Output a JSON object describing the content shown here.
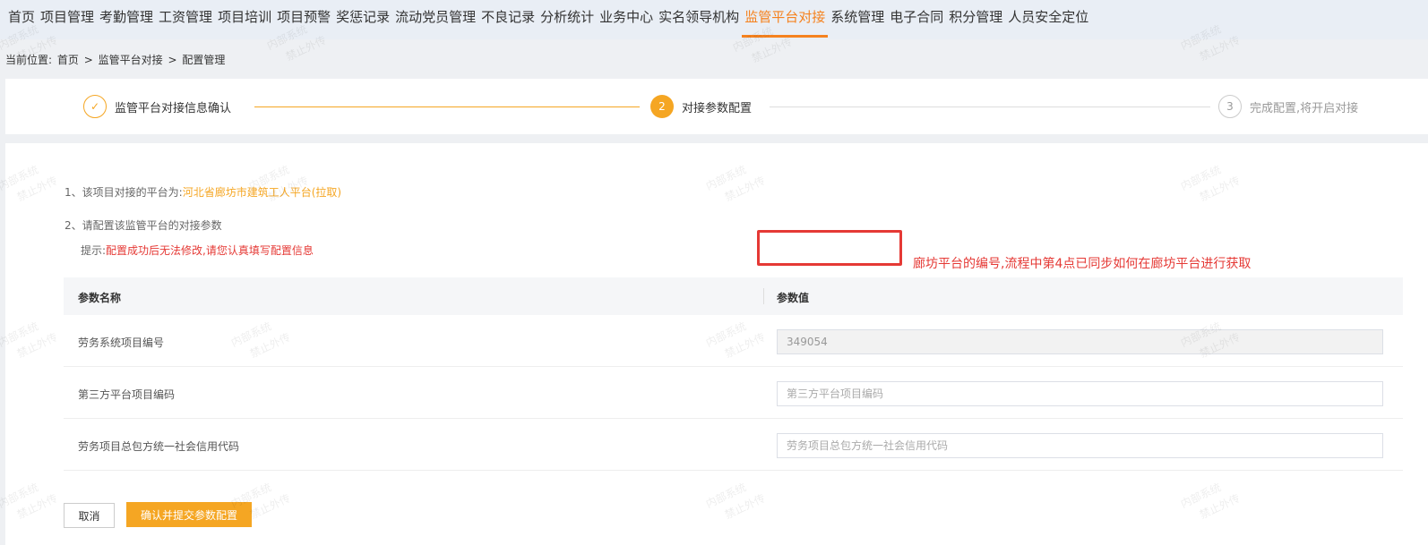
{
  "nav": {
    "items": [
      "首页",
      "项目管理",
      "考勤管理",
      "工资管理",
      "项目培训",
      "项目预警",
      "奖惩记录",
      "流动党员管理",
      "不良记录",
      "分析统计",
      "业务中心",
      "实名领导机构",
      "监管平台对接",
      "系统管理",
      "电子合同",
      "积分管理",
      "人员安全定位"
    ],
    "active": "监管平台对接"
  },
  "breadcrumb": {
    "prefix": "当前位置:",
    "path": [
      "首页",
      ">",
      "监管平台对接",
      ">",
      "配置管理"
    ]
  },
  "steps": [
    {
      "index": "✓",
      "label": "监管平台对接信息确认",
      "state": "done"
    },
    {
      "index": "2",
      "label": "对接参数配置",
      "state": "current"
    },
    {
      "index": "3",
      "label": "完成配置,将开启对接",
      "state": "pending"
    }
  ],
  "info": {
    "line1_prefix": "1、该项目对接的平台为:",
    "line1_platform": "河北省廊坊市建筑工人平台(拉取)",
    "line2": "2、请配置该监管平台的对接参数",
    "hint_prefix": "提示:",
    "hint_text": "配置成功后无法修改,请您认真填写配置信息"
  },
  "table": {
    "col_name": "参数名称",
    "col_value": "参数值",
    "rows": [
      {
        "name": "劳务系统项目编号",
        "value": "349054",
        "placeholder": "",
        "disabled": true
      },
      {
        "name": "第三方平台项目编码",
        "value": "",
        "placeholder": "第三方平台项目编码",
        "disabled": false
      },
      {
        "name": "劳务项目总包方统一社会信用代码",
        "value": "",
        "placeholder": "劳务项目总包方统一社会信用代码",
        "disabled": false
      }
    ]
  },
  "annotation": "廊坊平台的编号,流程中第4点已同步如何在廊坊平台进行获取",
  "buttons": {
    "cancel": "取消",
    "submit": "确认并提交参数配置"
  },
  "watermark": {
    "line1": "内部系统",
    "line2": "禁止外传"
  },
  "colors": {
    "accent": "#f5a623",
    "nav_active": "#f5821f",
    "warning": "#e53935"
  }
}
